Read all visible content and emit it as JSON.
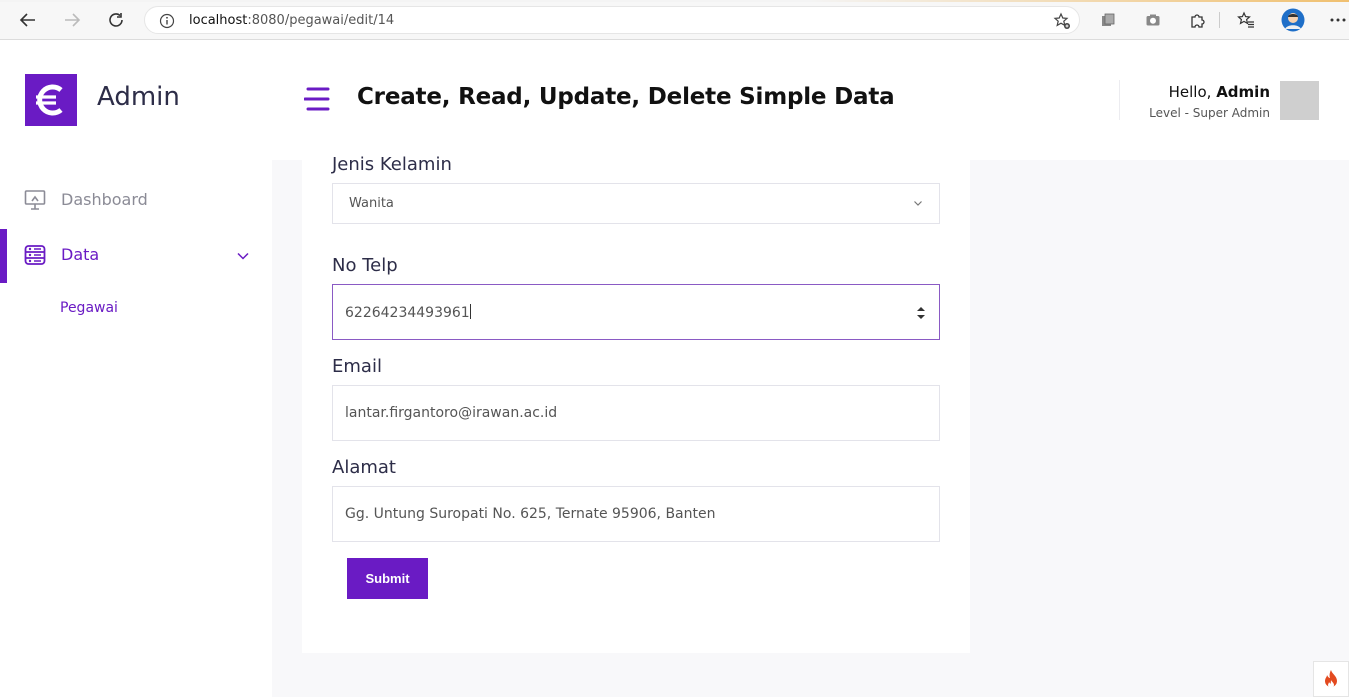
{
  "browser": {
    "url_host": "localhost",
    "url_path": ":8080/pegawai/edit/14"
  },
  "sidebar": {
    "brand": "Admin",
    "logo_icon": "euro-c-logo-icon",
    "items": [
      {
        "label": "Dashboard",
        "icon": "monitor-icon"
      },
      {
        "label": "Data",
        "icon": "database-icon"
      }
    ],
    "submenu": [
      "Pegawai"
    ]
  },
  "header": {
    "title": "Create, Read, Update, Delete Simple Data",
    "hello_prefix": "Hello,",
    "user_name": "Admin",
    "level": "Level - Super Admin"
  },
  "form": {
    "gender_label": "Jenis Kelamin",
    "gender_value": "Wanita",
    "phone_label": "No Telp",
    "phone_value": "62264234493961",
    "email_label": "Email",
    "email_value": "lantar.firgantoro@irawan.ac.id",
    "address_label": "Alamat",
    "address_value": "Gg. Untung Suropati No. 625, Ternate 95906, Banten",
    "submit_label": "Submit"
  },
  "colors": {
    "accent": "#6a1bc4",
    "bg": "#f8f8fa"
  }
}
